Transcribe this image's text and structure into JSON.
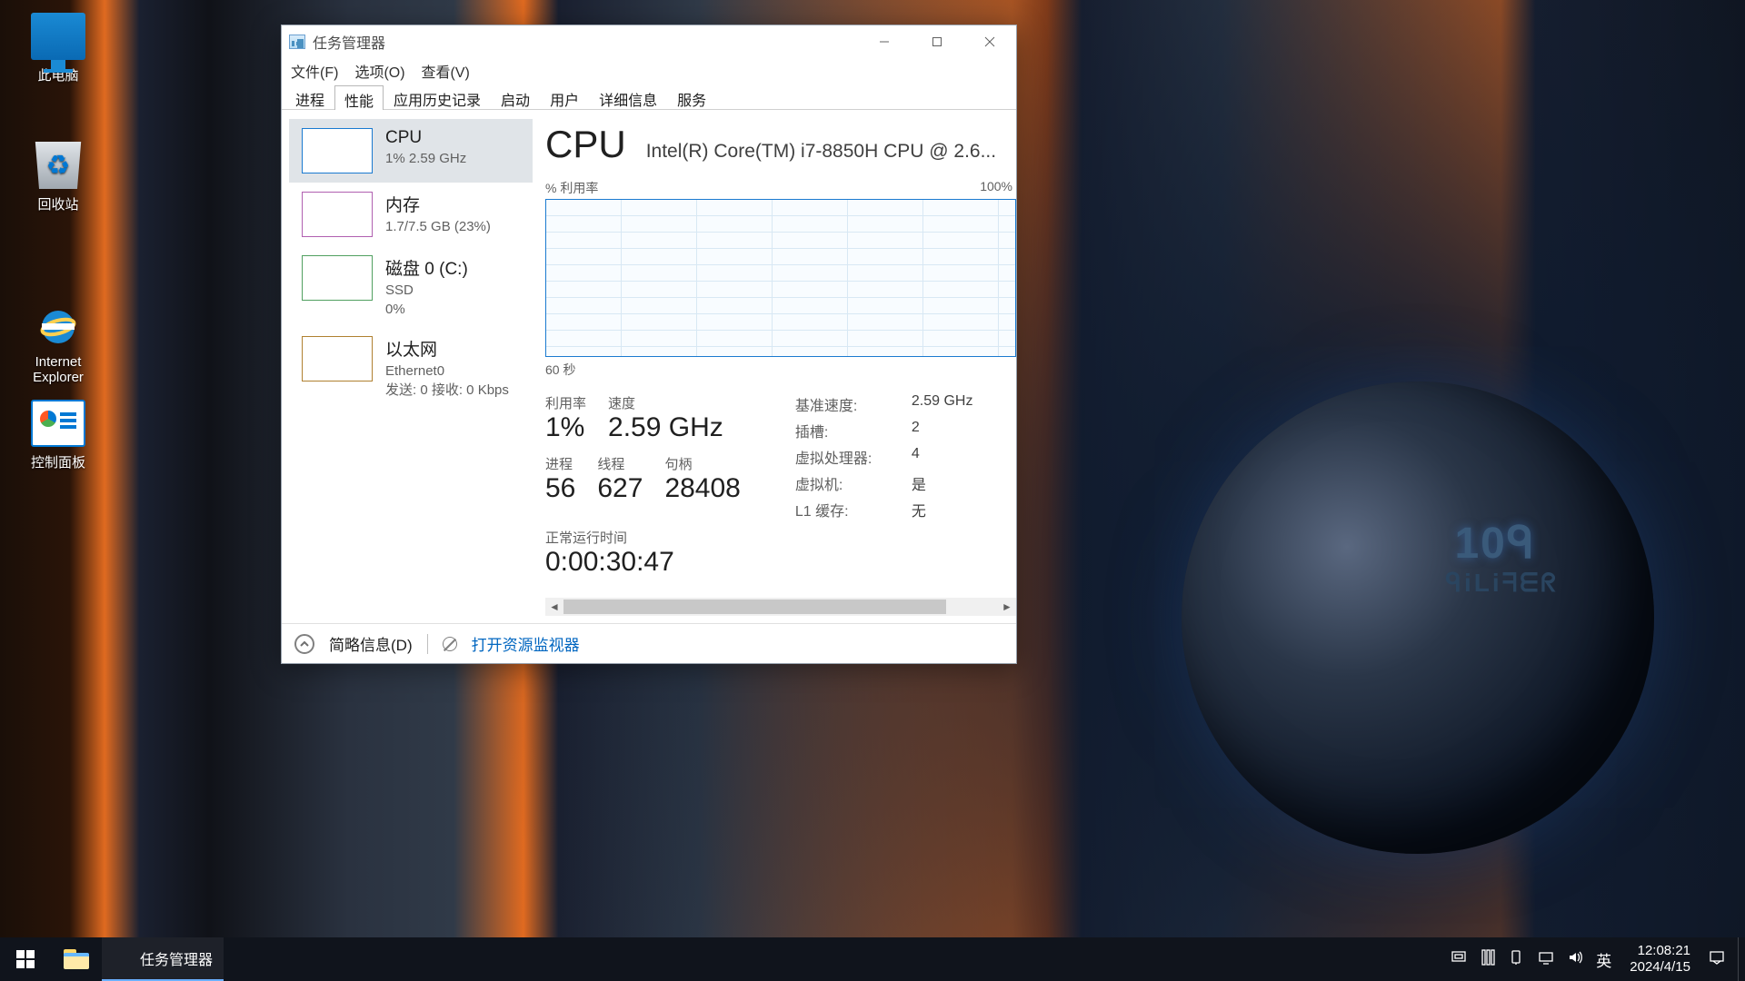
{
  "desktop_icons": {
    "this_pc": "此电脑",
    "recycle_bin": "回收站",
    "ie": "Internet\nExplorer",
    "control_panel": "控制面板"
  },
  "window": {
    "title": "任务管理器",
    "menu": {
      "file": "文件(F)",
      "options": "选项(O)",
      "view": "查看(V)"
    },
    "tabs": {
      "processes": "进程",
      "performance": "性能",
      "app_history": "应用历史记录",
      "startup": "启动",
      "users": "用户",
      "details": "详细信息",
      "services": "服务"
    }
  },
  "sidebar": {
    "cpu": {
      "name": "CPU",
      "sub": "1%  2.59 GHz"
    },
    "mem": {
      "name": "内存",
      "sub": "1.7/7.5 GB (23%)"
    },
    "disk": {
      "name": "磁盘 0 (C:)",
      "sub1": "SSD",
      "sub2": "0%"
    },
    "net": {
      "name": "以太网",
      "sub1": "Ethernet0",
      "sub2": "发送: 0  接收: 0 Kbps"
    }
  },
  "detail": {
    "title": "CPU",
    "model": "Intel(R) Core(TM) i7-8850H CPU @ 2.6...",
    "util_label": "% 利用率",
    "util_max": "100%",
    "xaxis": "60 秒",
    "labels": {
      "utilization": "利用率",
      "speed": "速度",
      "processes": "进程",
      "threads": "线程",
      "handles": "句柄",
      "base_speed": "基准速度:",
      "sockets": "插槽:",
      "logical": "虚拟处理器:",
      "vm": "虚拟机:",
      "l1": "L1 缓存:",
      "uptime": "正常运行时间"
    },
    "values": {
      "utilization": "1%",
      "speed": "2.59 GHz",
      "processes": "56",
      "threads": "627",
      "handles": "28408",
      "base_speed": "2.59 GHz",
      "sockets": "2",
      "logical": "4",
      "vm": "是",
      "l1": "无",
      "uptime": "0:00:30:47"
    }
  },
  "footer": {
    "fewer_details": "简略信息(D)",
    "resmon": "打开资源监视器"
  },
  "taskbar": {
    "task": "任务管理器",
    "ime": "英",
    "time": "12:08:21",
    "date": "2024/4/15"
  },
  "chart_data": {
    "type": "line",
    "title": "% 利用率",
    "xlabel": "60 秒",
    "ylabel": "% 利用率",
    "ylim": [
      0,
      100
    ],
    "x": [
      0,
      5,
      10,
      15,
      20,
      25,
      30,
      35,
      40,
      45,
      50,
      55,
      60
    ],
    "series": [
      {
        "name": "CPU",
        "values": [
          1,
          1,
          1,
          1,
          1,
          1,
          1,
          1,
          1,
          1,
          1,
          1,
          1
        ]
      }
    ]
  }
}
